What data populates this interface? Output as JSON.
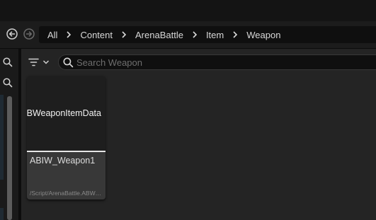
{
  "navigation": {
    "back_icon": "circle-arrow-left-icon",
    "forward_icon": "circle-arrow-right-icon"
  },
  "breadcrumb": {
    "items": [
      "All",
      "Content",
      "ArenaBattle",
      "Item",
      "Weapon"
    ],
    "separator_icon": "chevron-right-icon"
  },
  "left_panel": {
    "search_icon": "search-icon"
  },
  "toolbar": {
    "filter_icon": "filter-icon",
    "dropdown_icon": "chevron-down-icon"
  },
  "search": {
    "placeholder": "Search Weapon",
    "value": ""
  },
  "assets": [
    {
      "thumbnail_label": "ABWeaponItemData",
      "name": "ABIW_Weapon1",
      "path": "/Script/ArenaBattle.ABWeaponItemData",
      "type_color": "#e6e6e6"
    }
  ],
  "colors": {
    "background": "#151515",
    "panel": "#242424",
    "tile": "#383838",
    "thumbnail": "#1e1e1e"
  }
}
